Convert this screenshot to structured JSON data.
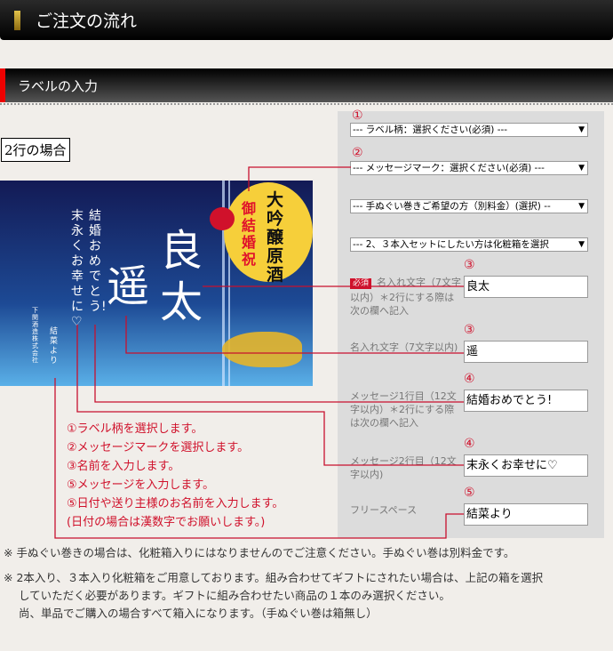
{
  "header": {
    "title": "ご注文の流れ"
  },
  "section": {
    "title": "ラベルの入力"
  },
  "case_label": "2行の場合",
  "colors": {
    "accent_red": "#d0112b",
    "header_gold": "#c9a227"
  },
  "label_preview": {
    "brand": "大吟醸原酒",
    "mark": "御結婚祝",
    "name1": "良太",
    "name2": "遥",
    "message1": "結婚おめでとう!",
    "message2": "末永くお幸せに♡",
    "sender": "結菜より",
    "maker": "下関酒造株式会社"
  },
  "form": {
    "selects": [
      {
        "num": "①",
        "value": "--- ラベル柄：選択ください(必須) ---"
      },
      {
        "num": "②",
        "value": "--- メッセージマーク：選択ください(必須) ---"
      },
      {
        "num": "",
        "value": "--- 手ぬぐい巻きご希望の方（別料金）(選択) --"
      },
      {
        "num": "",
        "value": "--- 2、３本入セットにしたい方は化粧箱を選択"
      }
    ],
    "fields": [
      {
        "num": "③",
        "required": "必須",
        "label": "名入れ文字（7文字以内）＊2行にする際は次の欄へ記入",
        "value": "良太"
      },
      {
        "num": "③",
        "required": "",
        "label": "名入れ文字（7文字以内)",
        "value": "遥"
      },
      {
        "num": "④",
        "required": "",
        "label": "メッセージ1行目（12文字以内）＊2行にする際は次の欄へ記入",
        "value": "結婚おめでとう!"
      },
      {
        "num": "④",
        "required": "",
        "label": "メッセージ2行目（12文字以内)",
        "value": "末永くお幸せに♡"
      },
      {
        "num": "⑤",
        "required": "",
        "label": "フリースペース",
        "value": "結菜より"
      }
    ]
  },
  "instructions": [
    "①ラベル柄を選択します。",
    "②メッセージマークを選択します。",
    "③名前を入力します。",
    "⑤メッセージを入力します。",
    "⑤日付や送り主様のお名前を入力します。",
    "(日付の場合は漢数字でお願いします。)"
  ],
  "notes": [
    "※ 手ぬぐい巻きの場合は、化粧箱入りにはなりませんのでご注意ください。手ぬぐい巻は別料金です。",
    "※ 2本入り、３本入り化粧箱をご用意しております。組み合わせてギフトにされたい場合は、上記の箱を選択",
    "していただく必要があります。ギフトに組み合わせたい商品の１本のみ選択ください。",
    "尚、単品でご購入の場合すべて箱入になります。（手ぬぐい巻は箱無し）"
  ]
}
